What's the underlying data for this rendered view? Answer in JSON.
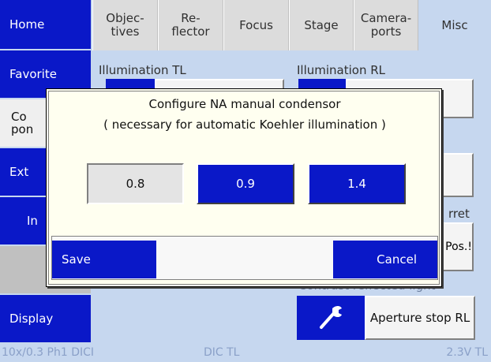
{
  "sidebar": {
    "items": [
      {
        "label": "Home"
      },
      {
        "label": "Favorite"
      },
      {
        "label": "Co\npon"
      },
      {
        "label": "Ext"
      },
      {
        "label": "In"
      },
      {
        "label": ""
      },
      {
        "label": "Display"
      }
    ]
  },
  "tabs": [
    {
      "label": "Objec-\ntives"
    },
    {
      "label": "Re-\nflector"
    },
    {
      "label": "Focus"
    },
    {
      "label": "Stage"
    },
    {
      "label": "Camera-\nports"
    },
    {
      "label": "Misc"
    }
  ],
  "panel": {
    "illumination_tl_label": "Illumination TL",
    "illumination_rl_label": "Illumination RL",
    "turret_label": "rret",
    "pos_label": "Pos.!",
    "contrast_label": "Contrast reflected light",
    "aperture_stop_label": "Aperture stop RL",
    "aperture_icon": "wrench-icon"
  },
  "status_bar": {
    "left": "10x/0.3 Ph1 DICI",
    "middle": "DIC TL",
    "right": "2.3V TL"
  },
  "dialog": {
    "title_line1": "Configure NA manual condensor",
    "title_line2": "( necessary for automatic Koehler illumination )",
    "values": [
      "0.8",
      "0.9",
      "1.4"
    ],
    "selected_value": "0.8",
    "save_label": "Save",
    "cancel_label": "Cancel"
  },
  "colors": {
    "accent": "#0a18c8",
    "background": "#c6d7ef",
    "dialog_background": "#fffff0"
  }
}
